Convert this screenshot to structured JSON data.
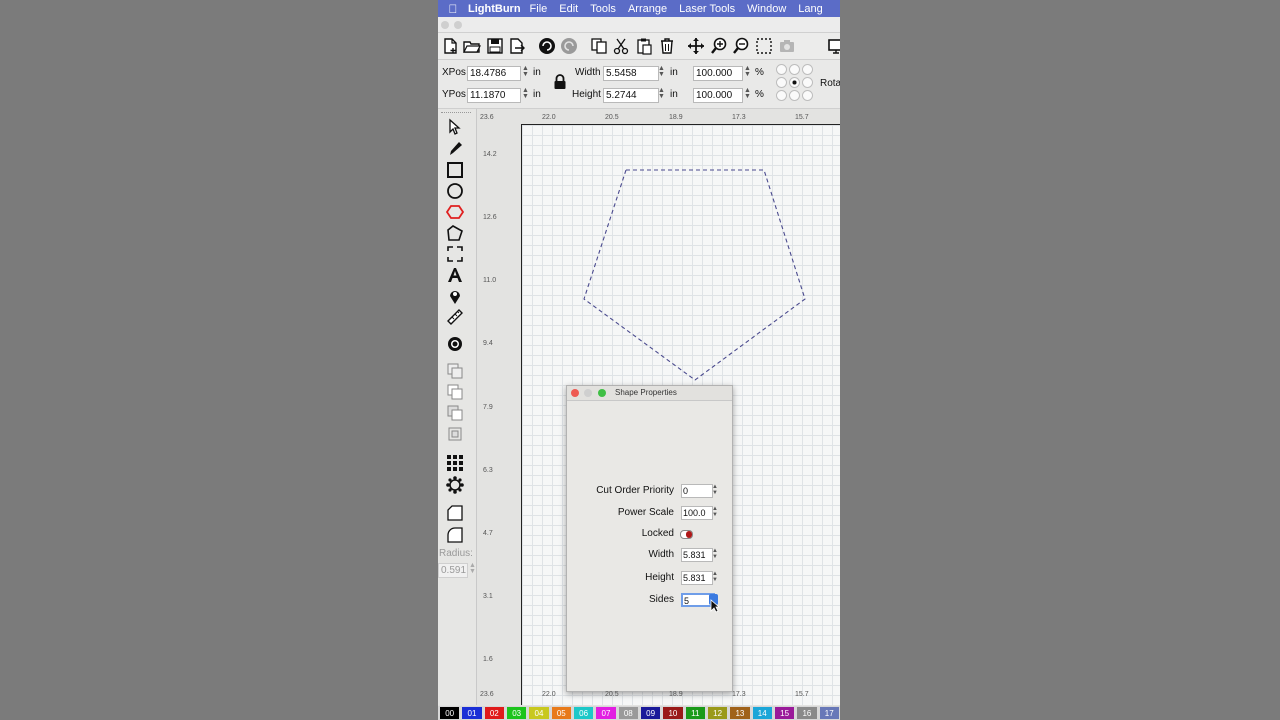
{
  "menubar": {
    "app_name": "LightBurn",
    "items": [
      "File",
      "Edit",
      "Tools",
      "Arrange",
      "Laser Tools",
      "Window",
      "Lang"
    ]
  },
  "editbar": {
    "xpos_label": "XPos",
    "xpos_value": "18.4786",
    "xpos_unit": "in",
    "ypos_label": "YPos",
    "ypos_value": "11.1870",
    "ypos_unit": "in",
    "width_label": "Width",
    "width_value": "5.5458",
    "width_unit": "in",
    "height_label": "Height",
    "height_value": "5.2744",
    "height_unit": "in",
    "scale_x_value": "100.000",
    "scale_x_unit": "%",
    "scale_y_value": "100.000",
    "scale_y_unit": "%",
    "rotate_label": "Rota"
  },
  "toolbar_icons": [
    "new-file-icon",
    "open-folder-icon",
    "save-icon",
    "export-icon",
    "undo-icon",
    "redo-icon",
    "copy-icon",
    "cut-icon",
    "paste-icon",
    "delete-icon",
    "move-icon",
    "zoom-in-icon",
    "zoom-out-icon",
    "zoom-frame-icon",
    "camera-icon",
    "monitor-icon"
  ],
  "palette": {
    "radius_label": "Radius:",
    "radius_value": "0.591"
  },
  "rulers": {
    "top": [
      "23.6",
      "22.0",
      "20.5",
      "18.9",
      "17.3",
      "15.7"
    ],
    "left": [
      "14.2",
      "12.6",
      "11.0",
      "9.4",
      "7.9",
      "6.3",
      "4.7",
      "3.1",
      "1.6"
    ],
    "bottom": [
      "23.6",
      "22.0",
      "20.5",
      "18.9",
      "17.3",
      "15.7"
    ]
  },
  "dialog": {
    "title": "Shape Properties",
    "cut_order_label": "Cut Order Priority",
    "cut_order_value": "0",
    "power_scale_label": "Power Scale",
    "power_scale_value": "100.0",
    "locked_label": "Locked",
    "width_label": "Width",
    "width_value": "5.831",
    "height_label": "Height",
    "height_value": "5.831",
    "sides_label": "Sides",
    "sides_value": "5"
  },
  "layers": [
    {
      "label": "00",
      "color": "#000000"
    },
    {
      "label": "01",
      "color": "#1a2fd6"
    },
    {
      "label": "02",
      "color": "#e01b1b"
    },
    {
      "label": "03",
      "color": "#1cc41c"
    },
    {
      "label": "04",
      "color": "#c8c81e"
    },
    {
      "label": "05",
      "color": "#e87a1a"
    },
    {
      "label": "06",
      "color": "#1cc8c8"
    },
    {
      "label": "07",
      "color": "#e21ee2"
    },
    {
      "label": "08",
      "color": "#9a9a9a"
    },
    {
      "label": "09",
      "color": "#1a1a9a"
    },
    {
      "label": "10",
      "color": "#9a1a1a"
    },
    {
      "label": "11",
      "color": "#1a9a1a"
    },
    {
      "label": "12",
      "color": "#9a9a1a"
    },
    {
      "label": "13",
      "color": "#a0621a"
    },
    {
      "label": "14",
      "color": "#1aa6d8"
    },
    {
      "label": "15",
      "color": "#9a1a9a"
    },
    {
      "label": "16",
      "color": "#8a8a8a"
    },
    {
      "label": "17",
      "color": "#6878b8"
    }
  ]
}
